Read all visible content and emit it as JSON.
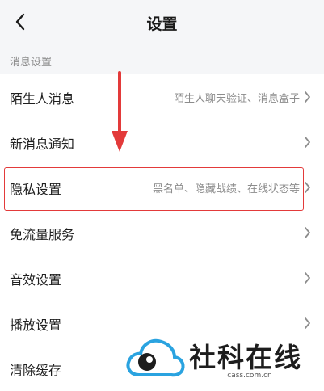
{
  "header": {
    "title": "设置"
  },
  "section": {
    "title": "消息设置"
  },
  "items": [
    {
      "label": "陌生人消息",
      "value": "陌生人聊天验证、消息盒子"
    },
    {
      "label": "新消息通知",
      "value": ""
    },
    {
      "label": "隐私设置",
      "value": "黑名单、隐藏战绩、在线状态等"
    },
    {
      "label": "免流量服务",
      "value": ""
    },
    {
      "label": "音效设置",
      "value": ""
    },
    {
      "label": "播放设置",
      "value": ""
    },
    {
      "label": "清除缓存",
      "value": ""
    }
  ],
  "watermark": {
    "name": "社科在线",
    "domain": "cass.com.cn"
  },
  "colors": {
    "accent_red": "#e33a3a",
    "logo_blue": "#2aa3e0"
  }
}
